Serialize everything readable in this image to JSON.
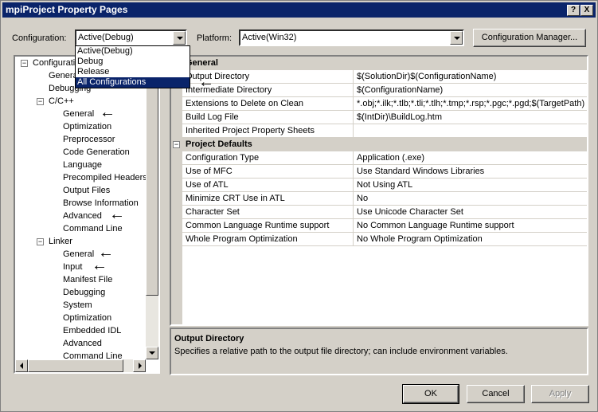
{
  "window": {
    "title": "mpiProject Property Pages",
    "help_glyph": "?",
    "close_glyph": "X"
  },
  "header": {
    "configuration_label": "Configuration:",
    "configuration_value": "Active(Debug)",
    "platform_label": "Platform:",
    "platform_value": "Active(Win32)",
    "config_manager_label": "Configuration Manager..."
  },
  "dropdown": {
    "items": [
      "Active(Debug)",
      "Debug",
      "Release",
      "All Configurations"
    ],
    "selected": "All Configurations"
  },
  "tree": {
    "root": "Configuration Properties",
    "root_children": [
      "General",
      "Debugging"
    ],
    "cpp": {
      "label": "C/C++",
      "children": [
        "General",
        "Optimization",
        "Preprocessor",
        "Code Generation",
        "Language",
        "Precompiled Headers",
        "Output Files",
        "Browse Information",
        "Advanced",
        "Command Line"
      ]
    },
    "linker": {
      "label": "Linker",
      "children": [
        "General",
        "Input",
        "Manifest File",
        "Debugging",
        "System",
        "Optimization",
        "Embedded IDL",
        "Advanced",
        "Command Line"
      ]
    }
  },
  "grid": {
    "sections": [
      {
        "title": "General",
        "rows": [
          {
            "name": "Output Directory",
            "value": "$(SolutionDir)$(ConfigurationName)"
          },
          {
            "name": "Intermediate Directory",
            "value": "$(ConfigurationName)"
          },
          {
            "name": "Extensions to Delete on Clean",
            "value": "*.obj;*.ilk;*.tlb;*.tli;*.tlh;*.tmp;*.rsp;*.pgc;*.pgd;$(TargetPath)"
          },
          {
            "name": "Build Log File",
            "value": "$(IntDir)\\BuildLog.htm"
          },
          {
            "name": "Inherited Project Property Sheets",
            "value": ""
          }
        ]
      },
      {
        "title": "Project Defaults",
        "rows": [
          {
            "name": "Configuration Type",
            "value": "Application (.exe)"
          },
          {
            "name": "Use of MFC",
            "value": "Use Standard Windows Libraries"
          },
          {
            "name": "Use of ATL",
            "value": "Not Using ATL"
          },
          {
            "name": "Minimize CRT Use in ATL",
            "value": "No"
          },
          {
            "name": "Character Set",
            "value": "Use Unicode Character Set"
          },
          {
            "name": "Common Language Runtime support",
            "value": "No Common Language Runtime support"
          },
          {
            "name": "Whole Program Optimization",
            "value": "No Whole Program Optimization"
          }
        ]
      }
    ]
  },
  "description": {
    "title": "Output Directory",
    "text": "Specifies a relative path to the output file directory; can include environment variables."
  },
  "buttons": {
    "ok": "OK",
    "cancel": "Cancel",
    "apply": "Apply"
  },
  "annotations": {
    "arrow_glyph": "←"
  }
}
